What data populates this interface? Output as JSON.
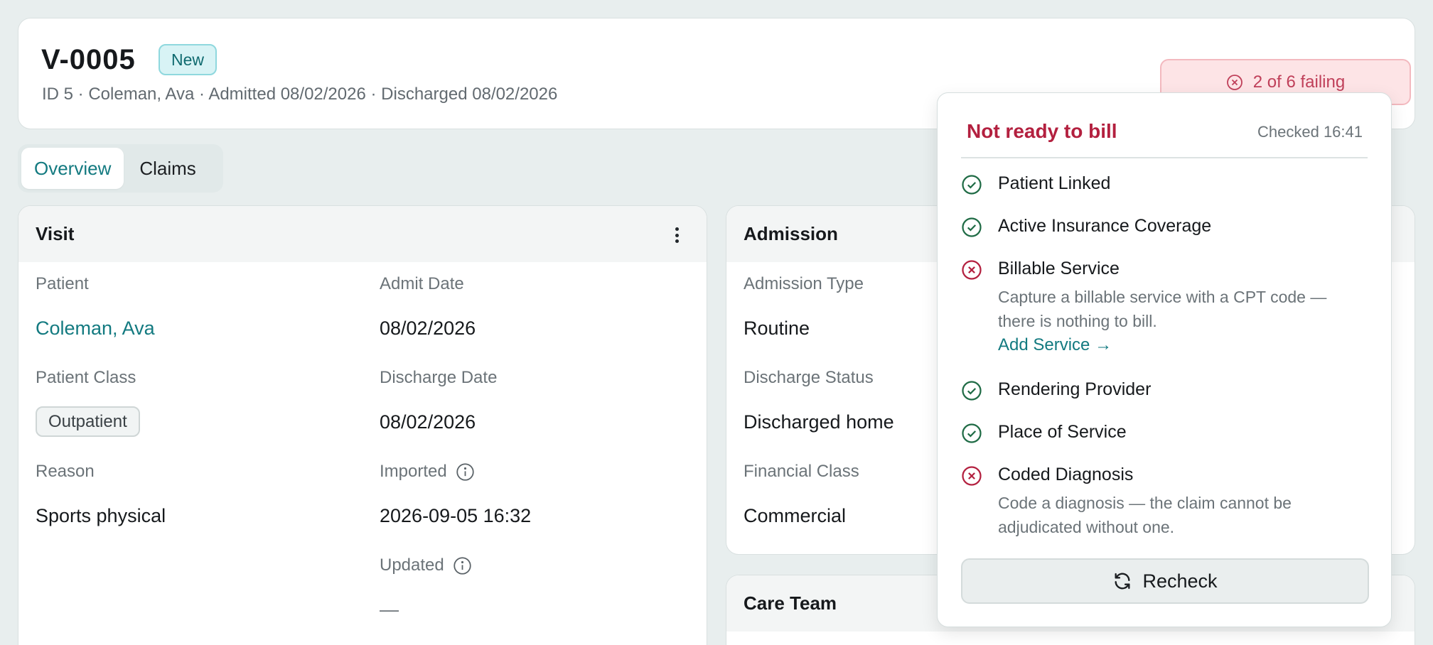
{
  "header": {
    "visit_id": "V-0005",
    "status_badge": "New",
    "meta": "ID 5 · Coleman, Ava · Admitted 08/02/2026 · Discharged 08/02/2026",
    "failing_label": "2 of 6 failing"
  },
  "tabs": [
    {
      "label": "Overview",
      "active": true
    },
    {
      "label": "Claims",
      "active": false
    }
  ],
  "visit_card": {
    "title": "Visit",
    "fields": {
      "patient_label": "Patient",
      "patient_value": "Coleman, Ava",
      "admit_date_label": "Admit Date",
      "admit_date_value": "08/02/2026",
      "patient_class_label": "Patient Class",
      "patient_class_value": "Outpatient",
      "discharge_date_label": "Discharge Date",
      "discharge_date_value": "08/02/2026",
      "reason_label": "Reason",
      "reason_value": "Sports physical",
      "imported_label": "Imported",
      "imported_value": "2026-09-05 16:32",
      "updated_label": "Updated",
      "updated_value": "—"
    }
  },
  "admission_card": {
    "title": "Admission",
    "fields": {
      "admission_type_label": "Admission Type",
      "admission_type_value": "Routine",
      "discharge_status_label": "Discharge Status",
      "discharge_status_value": "Discharged home",
      "financial_class_label": "Financial Class",
      "financial_class_value": "Commercial"
    }
  },
  "care_team_card": {
    "title": "Care Team"
  },
  "readiness": {
    "title": "Not ready to bill",
    "checked": "Checked 16:41",
    "items": [
      {
        "label": "Patient Linked",
        "status": "pass"
      },
      {
        "label": "Active Insurance Coverage",
        "status": "pass"
      },
      {
        "label": "Billable Service",
        "status": "fail",
        "help": "Capture a billable service with a CPT code — there is nothing to bill.",
        "action": "Add Service →"
      },
      {
        "label": "Rendering Provider",
        "status": "pass"
      },
      {
        "label": "Place of Service",
        "status": "pass"
      },
      {
        "label": "Coded Diagnosis",
        "status": "fail",
        "help": "Code a diagnosis — the claim cannot be adjudicated without one."
      }
    ],
    "recheck_label": "Recheck"
  },
  "colors": {
    "accent": "#137a80",
    "fail": "#b3203f",
    "pass": "#1f6b45",
    "page_bg": "#e8eeee"
  }
}
